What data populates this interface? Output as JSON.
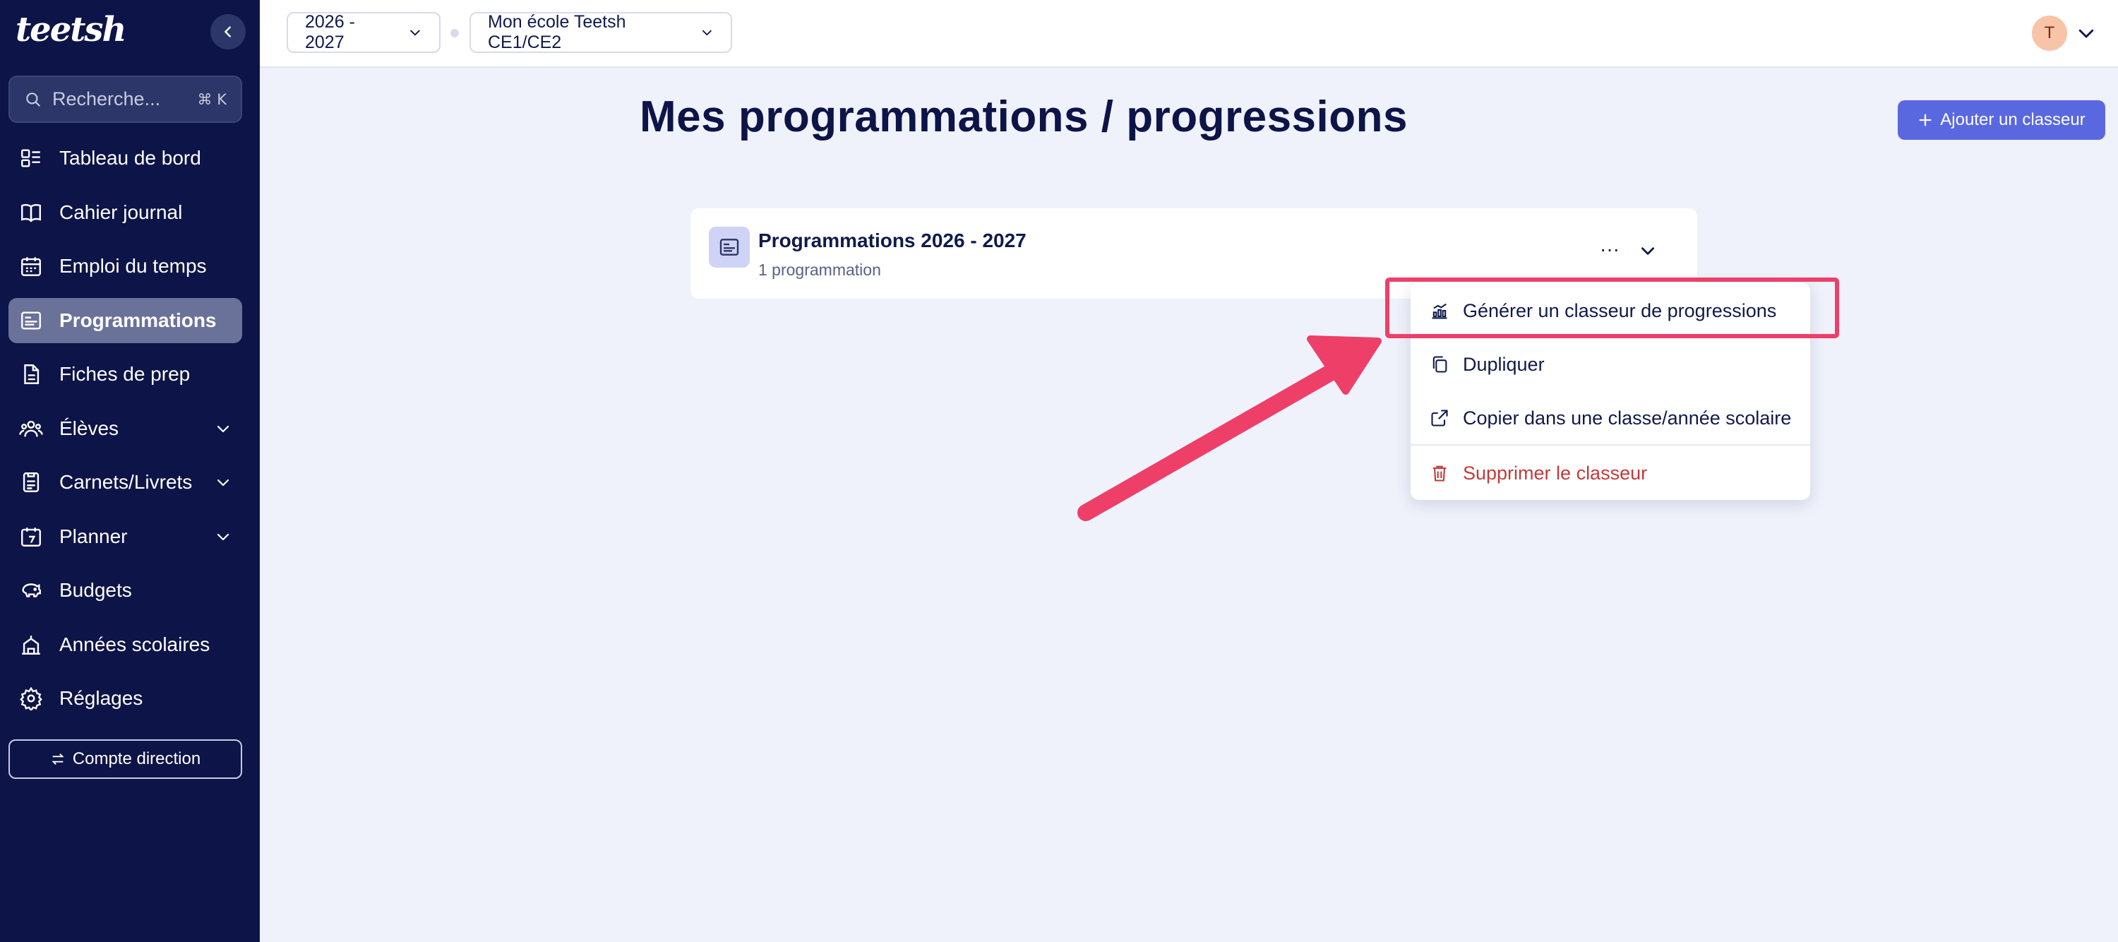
{
  "sidebar": {
    "logo_text": "teetsh",
    "search": {
      "placeholder": "Recherche...",
      "shortcut": "⌘ K"
    },
    "items": [
      {
        "label": "Tableau de bord",
        "icon": "dashboard-icon"
      },
      {
        "label": "Cahier journal",
        "icon": "book-icon"
      },
      {
        "label": "Emploi du temps",
        "icon": "calendar-icon"
      },
      {
        "label": "Programmations",
        "icon": "programmation-icon",
        "active": true
      },
      {
        "label": "Fiches de prep",
        "icon": "document-icon"
      },
      {
        "label": "Élèves",
        "icon": "students-icon",
        "expandable": true
      },
      {
        "label": "Carnets/Livrets",
        "icon": "notebook-icon",
        "expandable": true
      },
      {
        "label": "Planner",
        "icon": "planner-icon",
        "expandable": true
      },
      {
        "label": "Budgets",
        "icon": "piggy-bank-icon"
      },
      {
        "label": "Années scolaires",
        "icon": "school-icon"
      },
      {
        "label": "Réglages",
        "icon": "gear-icon"
      }
    ],
    "compte_direction": "Compte direction"
  },
  "topbar": {
    "year_select": "2026 - 2027",
    "class_select": "Mon école Teetsh CE1/CE2",
    "avatar_initial": "T"
  },
  "main": {
    "title": "Mes programmations / progressions",
    "add_button": "Ajouter un classeur",
    "card": {
      "title": "Programmations 2026 - 2027",
      "subtitle": "1 programmation",
      "more": "···"
    },
    "menu": {
      "items": [
        {
          "label": "Générer un classeur de progressions",
          "icon": "chart-icon"
        },
        {
          "label": "Dupliquer",
          "icon": "copy-icon"
        },
        {
          "label": "Copier dans une classe/année scolaire",
          "icon": "external-link-icon"
        },
        {
          "label": "Supprimer le classeur",
          "icon": "trash-icon",
          "danger": true
        }
      ]
    }
  },
  "colors": {
    "sidebar_bg": "#0d1447",
    "accent": "#5a68e0",
    "highlight": "#ee3f68",
    "danger": "#c33a3a",
    "page_bg": "#eff2fb"
  }
}
